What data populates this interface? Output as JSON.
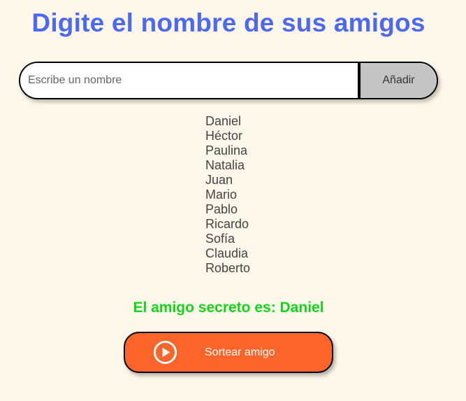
{
  "header": {
    "title": "Digite el nombre de sus amigos"
  },
  "form": {
    "input_value": "",
    "input_placeholder": "Escribe un nombre",
    "add_label": "Añadir"
  },
  "friends": [
    "Daniel",
    "Héctor",
    "Paulina",
    "Natalia",
    "Juan",
    "Mario",
    "Pablo",
    "Ricardo",
    "Sofía",
    "Claudia",
    "Roberto"
  ],
  "result": {
    "text": "El amigo secreto es: Daniel"
  },
  "draw_button": {
    "label": "Sortear amigo",
    "icon": "play-circle-icon"
  },
  "colors": {
    "background": "#fff8ea",
    "title": "#4b69f4",
    "result": "#11d61a",
    "draw_button": "#fe652b",
    "add_button": "#c4c4c4"
  }
}
